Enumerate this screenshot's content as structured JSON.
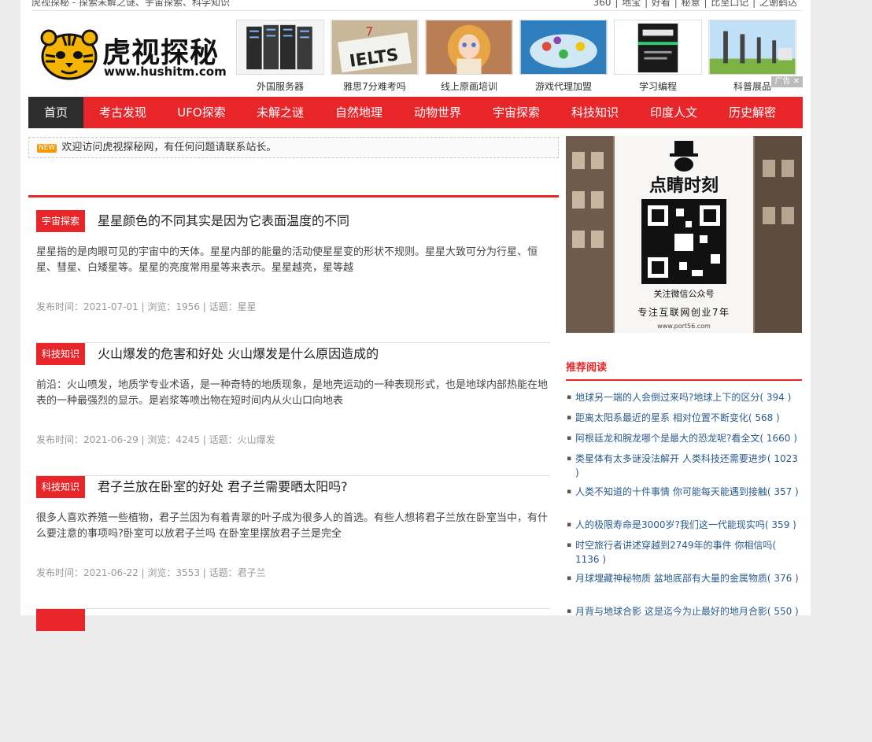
{
  "topbar": {
    "left_text": "虎视探秘 - 探索未解之谜、宇宙探索、科学知识",
    "right_links": [
      "360",
      "地宝",
      "好看",
      "秘意",
      "比至口记",
      "之谢鹤达"
    ]
  },
  "logo": {
    "title": "虎视探秘",
    "url": "www.hushitm.com"
  },
  "ads": {
    "items": [
      {
        "caption": "外国服务器",
        "icon": "server-rack-icon"
      },
      {
        "caption": "雅思7分难考吗",
        "icon": "ielts-book-icon"
      },
      {
        "caption": "线上原画培训",
        "icon": "anime-art-icon"
      },
      {
        "caption": "游戏代理加盟",
        "icon": "game-map-icon"
      },
      {
        "caption": "学习编程",
        "icon": "hacker-book-icon"
      },
      {
        "caption": "科普展品",
        "icon": "street-lamp-icon"
      }
    ],
    "tag": "广告"
  },
  "nav": {
    "items": [
      "首页",
      "考古发现",
      "UFO探索",
      "未解之谜",
      "自然地理",
      "动物世界",
      "宇宙探索",
      "科技知识",
      "印度人文",
      "历史解密"
    ],
    "active_index": 0
  },
  "notice": {
    "tag": "NEW",
    "text": "欢迎访问虎视探秘网，有任何问题请联系站长。"
  },
  "articles": [
    {
      "category": "宇宙探索",
      "title": "星星颜色的不同其实是因为它表面温度的不同",
      "desc": "星星指的是肉眼可见的宇宙中的天体。星星内部的能量的活动使星星变的形状不规则。星星大致可分为行星、恒星、彗星、白矮星等。星星的亮度常用星等来表示。星星越亮，星等越",
      "meta": "发布时间：2021-07-01 | 浏览：1956 | 话题：",
      "tag": "星星"
    },
    {
      "category": "科技知识",
      "title": "火山爆发的危害和好处 火山爆发是什么原因造成的",
      "desc": "前沿：火山喷发，地质学专业术语，是一种奇特的地质现象，是地壳运动的一种表现形式，也是地球内部热能在地表的一种最强烈的显示。是岩浆等喷出物在短时间内从火山口向地表",
      "meta": "发布时间：2021-06-29 | 浏览：4245 | 话题：",
      "tag": "火山爆发"
    },
    {
      "category": "科技知识",
      "title": "君子兰放在卧室的好处 君子兰需要晒太阳吗?",
      "desc": "很多人喜欢养殖一些植物，君子兰因为有着青翠的叶子成为很多人的首选。有些人想将君子兰放在卧室当中，有什么要注意的事项吗?卧室可以放君子兰吗 在卧室里摆放君子兰是完全",
      "meta": "发布时间：2021-06-22 | 浏览：3553 | 话题：",
      "tag": "君子兰"
    }
  ],
  "side_ad": {
    "brand": "点睛时刻",
    "qr_caption": "关注微信公众号",
    "slogan": "专注互联网创业7年",
    "site": "www.port56.com"
  },
  "recommend": {
    "heading": "推荐阅读",
    "items": [
      {
        "title": "地球另一端的人会倒过来吗?地球上下的区分",
        "count": "( 394 )"
      },
      {
        "title": "距离太阳系最近的星系 相对位置不断变化",
        "count": "( 568 )"
      },
      {
        "title": "阿根廷龙和腕龙哪个是最大的恐龙呢?看全文",
        "count": "( 1660 )"
      },
      {
        "title": "类星体有太多谜没法解开 人类科技还需要进步",
        "count": "( 1023 )"
      },
      {
        "title": "人类不知道的十件事情 你可能每天能遇到接触",
        "count": "( 357 )"
      },
      {
        "title": "人的极限寿命是3000岁?我们这一代能现实吗",
        "count": "( 359 )"
      },
      {
        "title": "时空旅行者讲述穿越到2749年的事件 你相信吗",
        "count": "( 1136 )"
      },
      {
        "title": "月球埋藏神秘物质 盆地底部有大量的金属物质",
        "count": "( 376 )"
      },
      {
        "title": "月背与地球合影 这是迄今为止最好的地月合影",
        "count": "( 550 )"
      }
    ]
  },
  "colors": {
    "accent": "#e8262a",
    "nav_active": "#2d2d2d",
    "link": "#2a5b8a"
  }
}
